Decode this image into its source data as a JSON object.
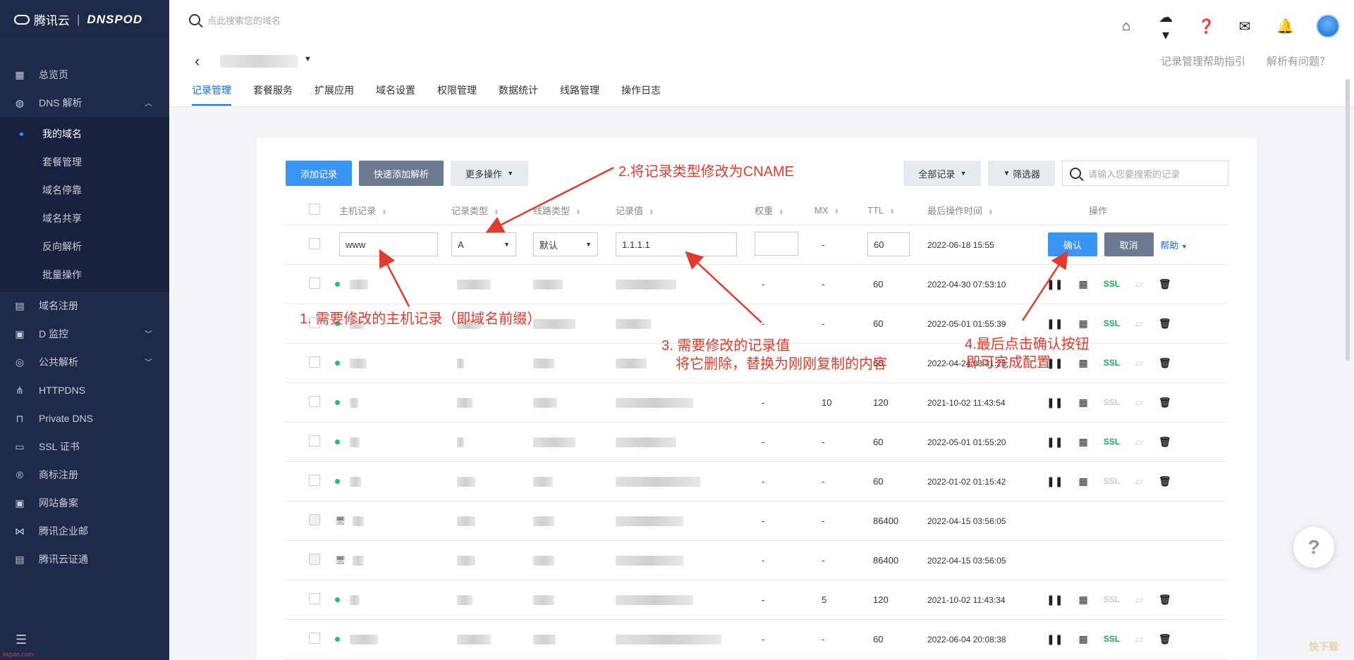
{
  "brand": {
    "cloud": "腾讯云",
    "dnspod": "DNSPOD"
  },
  "sidebar": {
    "items_top": [
      {
        "label": "总览页",
        "icon": "dashboard-icon"
      },
      {
        "label": "DNS 解析",
        "icon": "globe-icon"
      }
    ],
    "sub_items": [
      {
        "label": "我的域名",
        "active": true
      },
      {
        "label": "套餐管理"
      },
      {
        "label": "域名停靠"
      },
      {
        "label": "域名共享"
      },
      {
        "label": "反向解析"
      },
      {
        "label": "批量操作"
      }
    ],
    "items_bottom": [
      {
        "label": "域名注册",
        "icon": "register-icon"
      },
      {
        "label": "D 监控",
        "icon": "monitor-icon"
      },
      {
        "label": "公共解析",
        "icon": "public-dns-icon"
      },
      {
        "label": "HTTPDNS",
        "icon": "httpdns-icon"
      },
      {
        "label": "Private DNS",
        "icon": "lock-icon"
      },
      {
        "label": "SSL 证书",
        "icon": "certificate-icon"
      },
      {
        "label": "商标注册",
        "icon": "trademark-icon"
      },
      {
        "label": "网站备案",
        "icon": "record-icon"
      },
      {
        "label": "腾讯企业邮",
        "icon": "mail-icon"
      },
      {
        "label": "腾讯云证通",
        "icon": "id-card-icon"
      }
    ]
  },
  "topbar": {
    "search_placeholder": "点此搜索您的域名"
  },
  "header": {
    "help_guide": "记录管理帮助指引",
    "problem": "解析有问题？",
    "tabs": [
      "记录管理",
      "套餐服务",
      "扩展应用",
      "域名设置",
      "权限管理",
      "数据统计",
      "线路管理",
      "操作日志"
    ]
  },
  "toolbar": {
    "add": "添加记录",
    "quick_add": "快速添加解析",
    "more": "更多操作",
    "all_records": "全部记录",
    "filter": "筛选器",
    "search_placeholder": "请输入您要搜索的记录"
  },
  "table": {
    "columns": [
      "主机记录",
      "记录类型",
      "线路类型",
      "记录值",
      "权重",
      "MX",
      "TTL",
      "最后操作时间",
      "操作"
    ],
    "edit_row": {
      "host": "www",
      "type": "A",
      "line": "默认",
      "value": "1.1.1.1",
      "mx": "-",
      "ttl": "60",
      "time": "2022-06-18 15:55",
      "confirm": "确认",
      "cancel": "取消",
      "help": "帮助"
    },
    "rows": [
      {
        "weight": "-",
        "mx": "-",
        "ttl": "60",
        "time": "2022-04-30 07:53:10",
        "ssl": true,
        "kind": "dot"
      },
      {
        "weight": "-",
        "mx": "-",
        "ttl": "60",
        "time": "2022-05-01 01:55:39",
        "ssl": true,
        "kind": "dot"
      },
      {
        "weight": "",
        "mx": "",
        "ttl": "60",
        "time": "2022-04-24 03:31:23",
        "ssl": true,
        "kind": "dot"
      },
      {
        "weight": "-",
        "mx": "10",
        "ttl": "120",
        "time": "2021-10-02 11:43:54",
        "ssl": false,
        "kind": "dot"
      },
      {
        "weight": "-",
        "mx": "-",
        "ttl": "60",
        "time": "2022-05-01 01:55:20",
        "ssl": true,
        "kind": "dot"
      },
      {
        "weight": "-",
        "mx": "-",
        "ttl": "60",
        "time": "2022-01-02 01:15:42",
        "ssl": false,
        "kind": "dot"
      },
      {
        "weight": "-",
        "mx": "-",
        "ttl": "86400",
        "time": "2022-04-15 03:56:05",
        "ssl": null,
        "kind": "monitor"
      },
      {
        "weight": "-",
        "mx": "-",
        "ttl": "86400",
        "time": "2022-04-15 03:56:05",
        "ssl": null,
        "kind": "monitor"
      },
      {
        "weight": "-",
        "mx": "5",
        "ttl": "120",
        "time": "2021-10-02 11:43:34",
        "ssl": false,
        "kind": "dot"
      },
      {
        "weight": "-",
        "mx": "-",
        "ttl": "60",
        "time": "2022-06-04 20:08:38",
        "ssl": true,
        "kind": "dot"
      }
    ],
    "ssl_label": "SSL"
  },
  "annotations": {
    "a1": "1. 需要修改的主机记录（即域名前缀）",
    "a2": "2.将记录类型修改为CNAME",
    "a3_line1": "3. 需要修改的记录值",
    "a3_line2": "将它删除，替换为刚刚复制的内容",
    "a4_line1": "4.最后点击确认按钮",
    "a4_line2": "即可完成配置"
  },
  "help_fab": "?",
  "watermark_left": "kkpan.com",
  "watermark_right": "快下载",
  "colors": {
    "sidebar": "#1f2a4a",
    "primary": "#3b95f5",
    "accent": "#006eff",
    "annotation": "#e23b2e",
    "ssl": "#1ea85b"
  }
}
